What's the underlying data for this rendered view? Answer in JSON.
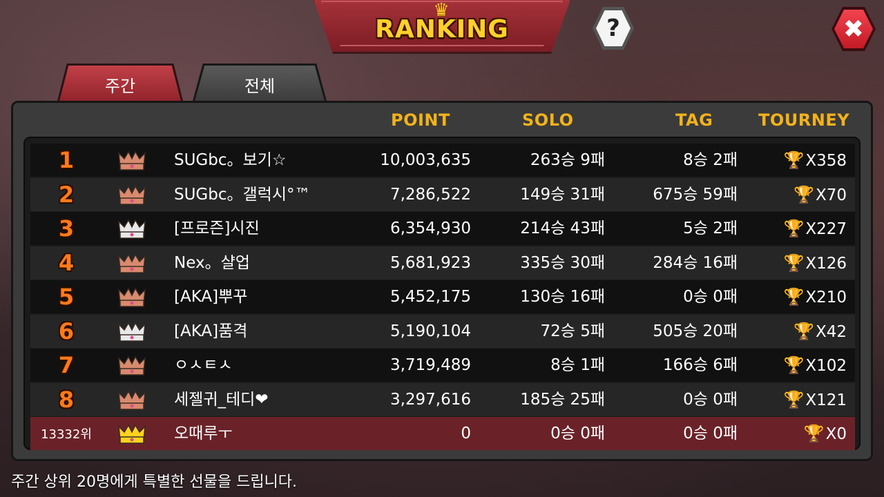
{
  "header": {
    "title": "RANKING",
    "help_label": "?",
    "close_label": "✖"
  },
  "tabs": [
    {
      "label": "주간",
      "active": true
    },
    {
      "label": "전체",
      "active": false
    }
  ],
  "columns": {
    "point": "POINT",
    "solo": "SOLO",
    "tag": "TAG",
    "tourney": "TOURNEY"
  },
  "rows": [
    {
      "rank": "1",
      "crown": "bronze",
      "name": "SUGbc。보기☆",
      "point": "10,003,635",
      "solo": "263승 9패",
      "tag": "8승 2패",
      "tourney": "X358"
    },
    {
      "rank": "2",
      "crown": "bronze",
      "name": "SUGbc。갤럭시°™",
      "point": "7,286,522",
      "solo": "149승 31패",
      "tag": "675승 59패",
      "tourney": "X70"
    },
    {
      "rank": "3",
      "crown": "silver",
      "name": "[프로즌]시진",
      "point": "6,354,930",
      "solo": "214승 43패",
      "tag": "5승 2패",
      "tourney": "X227"
    },
    {
      "rank": "4",
      "crown": "bronze",
      "name": "Nex。샬업",
      "point": "5,681,923",
      "solo": "335승 30패",
      "tag": "284승 16패",
      "tourney": "X126"
    },
    {
      "rank": "5",
      "crown": "bronze",
      "name": "[AKA]뿌꾸",
      "point": "5,452,175",
      "solo": "130승 16패",
      "tag": "0승 0패",
      "tourney": "X210"
    },
    {
      "rank": "6",
      "crown": "silver",
      "name": "[AKA]품격",
      "point": "5,190,104",
      "solo": "72승 5패",
      "tag": "505승 20패",
      "tourney": "X42"
    },
    {
      "rank": "7",
      "crown": "bronze",
      "name": "ㅇㅅㅌㅅ",
      "point": "3,719,489",
      "solo": "8승 1패",
      "tag": "166승 6패",
      "tourney": "X102"
    },
    {
      "rank": "8",
      "crown": "bronze",
      "name": "세젤귀_테디❤",
      "point": "3,297,616",
      "solo": "185승 25패",
      "tag": "0승 0패",
      "tourney": "X121"
    }
  ],
  "my_row": {
    "rank": "13332위",
    "crown": "gold",
    "name": "오때루ㅜ",
    "point": "0",
    "solo": "0승 0패",
    "tag": "0승 0패",
    "tourney": "X0"
  },
  "footer": "주간 상위 20명에게 특별한 선물을 드립니다.",
  "colors": {
    "bronze": "#d88a6e",
    "silver": "#e8e8e8",
    "gold": "#ffd21e",
    "accent": "#f2b21a",
    "rank_number": "#ff7a1a"
  }
}
